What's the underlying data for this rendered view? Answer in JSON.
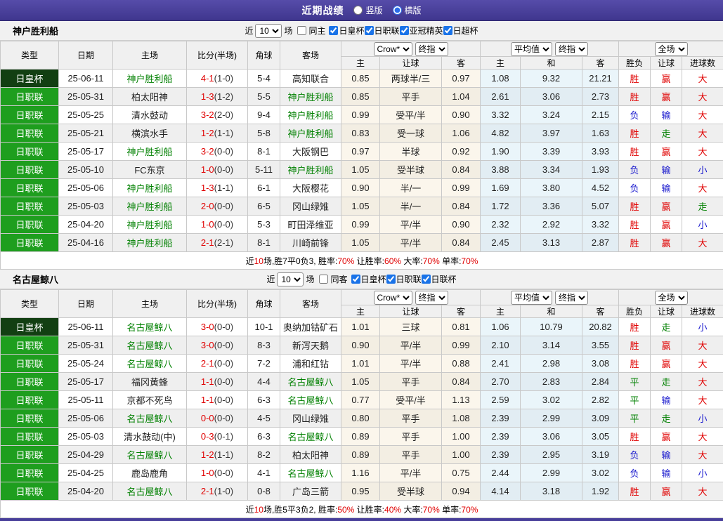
{
  "titlebar": {
    "title": "近期战绩",
    "radios": [
      {
        "label": "竖版",
        "checked": false
      },
      {
        "label": "横版",
        "checked": true
      }
    ]
  },
  "headers": {
    "main": [
      "类型",
      "日期",
      "主场",
      "比分(半场)",
      "角球",
      "客场"
    ],
    "sub": [
      "主",
      "让球",
      "客",
      "主",
      "和",
      "客",
      "胜负",
      "让球",
      "进球数"
    ],
    "odds_provider": "Crow*",
    "odds_stage": "终指",
    "avg_provider": "平均值",
    "avg_stage": "终指",
    "scope": "全场"
  },
  "tables": [
    {
      "team": "神户胜利船",
      "filter": {
        "prefix": "近",
        "count": "10",
        "suffix": "场",
        "venue_label": "同主",
        "venue_checked": false,
        "competitions": [
          {
            "label": "日皇杯",
            "checked": true
          },
          {
            "label": "日职联",
            "checked": true
          },
          {
            "label": "亚冠精英",
            "checked": true
          },
          {
            "label": "日超杯",
            "checked": true
          }
        ]
      },
      "rows": [
        {
          "type": "日皇杯",
          "cup": true,
          "date": "25-06-11",
          "home": "神户胜利船",
          "home_focus": true,
          "score": "4-1",
          "half": "(1-0)",
          "corner": "5-4",
          "away": "高知联合",
          "away_focus": false,
          "crow_home": "0.85",
          "crow_line": "两球半/三",
          "crow_away": "0.97",
          "avg_home": "1.08",
          "avg_draw": "9.32",
          "avg_away": "21.21",
          "res_outcome": {
            "t": "胜",
            "c": "red"
          },
          "res_handicap": {
            "t": "赢",
            "c": "red"
          },
          "res_goals": {
            "t": "大",
            "c": "red"
          }
        },
        {
          "type": "日职联",
          "cup": false,
          "date": "25-05-31",
          "home": "柏太阳神",
          "home_focus": false,
          "score": "1-3",
          "half": "(1-2)",
          "corner": "5-5",
          "away": "神户胜利船",
          "away_focus": true,
          "crow_home": "0.85",
          "crow_line": "平手",
          "crow_away": "1.04",
          "avg_home": "2.61",
          "avg_draw": "3.06",
          "avg_away": "2.73",
          "res_outcome": {
            "t": "胜",
            "c": "red"
          },
          "res_handicap": {
            "t": "赢",
            "c": "red"
          },
          "res_goals": {
            "t": "大",
            "c": "red"
          }
        },
        {
          "type": "日职联",
          "cup": false,
          "date": "25-05-25",
          "home": "清水鼓动",
          "home_focus": false,
          "score": "3-2",
          "half": "(2-0)",
          "corner": "9-4",
          "away": "神户胜利船",
          "away_focus": true,
          "crow_home": "0.99",
          "crow_line": "受平/半",
          "crow_away": "0.90",
          "avg_home": "3.32",
          "avg_draw": "3.24",
          "avg_away": "2.15",
          "res_outcome": {
            "t": "负",
            "c": "blue"
          },
          "res_handicap": {
            "t": "输",
            "c": "blue"
          },
          "res_goals": {
            "t": "大",
            "c": "red"
          }
        },
        {
          "type": "日职联",
          "cup": false,
          "date": "25-05-21",
          "home": "横滨水手",
          "home_focus": false,
          "score": "1-2",
          "half": "(1-1)",
          "corner": "5-8",
          "away": "神户胜利船",
          "away_focus": true,
          "crow_home": "0.83",
          "crow_line": "受一球",
          "crow_away": "1.06",
          "avg_home": "4.82",
          "avg_draw": "3.97",
          "avg_away": "1.63",
          "res_outcome": {
            "t": "胜",
            "c": "red"
          },
          "res_handicap": {
            "t": "走",
            "c": "green"
          },
          "res_goals": {
            "t": "大",
            "c": "red"
          }
        },
        {
          "type": "日职联",
          "cup": false,
          "date": "25-05-17",
          "home": "神户胜利船",
          "home_focus": true,
          "score": "3-2",
          "half": "(0-0)",
          "corner": "8-1",
          "away": "大阪钢巴",
          "away_focus": false,
          "crow_home": "0.97",
          "crow_line": "半球",
          "crow_away": "0.92",
          "avg_home": "1.90",
          "avg_draw": "3.39",
          "avg_away": "3.93",
          "res_outcome": {
            "t": "胜",
            "c": "red"
          },
          "res_handicap": {
            "t": "赢",
            "c": "red"
          },
          "res_goals": {
            "t": "大",
            "c": "red"
          }
        },
        {
          "type": "日职联",
          "cup": false,
          "date": "25-05-10",
          "home": "FC东京",
          "home_focus": false,
          "score": "1-0",
          "half": "(0-0)",
          "corner": "5-11",
          "away": "神户胜利船",
          "away_focus": true,
          "crow_home": "1.05",
          "crow_line": "受半球",
          "crow_away": "0.84",
          "avg_home": "3.88",
          "avg_draw": "3.34",
          "avg_away": "1.93",
          "res_outcome": {
            "t": "负",
            "c": "blue"
          },
          "res_handicap": {
            "t": "输",
            "c": "blue"
          },
          "res_goals": {
            "t": "小",
            "c": "blue"
          }
        },
        {
          "type": "日职联",
          "cup": false,
          "date": "25-05-06",
          "home": "神户胜利船",
          "home_focus": true,
          "score": "1-3",
          "half": "(1-1)",
          "corner": "6-1",
          "away": "大阪樱花",
          "away_focus": false,
          "crow_home": "0.90",
          "crow_line": "半/一",
          "crow_away": "0.99",
          "avg_home": "1.69",
          "avg_draw": "3.80",
          "avg_away": "4.52",
          "res_outcome": {
            "t": "负",
            "c": "blue"
          },
          "res_handicap": {
            "t": "输",
            "c": "blue"
          },
          "res_goals": {
            "t": "大",
            "c": "red"
          }
        },
        {
          "type": "日职联",
          "cup": false,
          "date": "25-05-03",
          "home": "神户胜利船",
          "home_focus": true,
          "score": "2-0",
          "half": "(0-0)",
          "corner": "6-5",
          "away": "冈山绿雉",
          "away_focus": false,
          "crow_home": "1.05",
          "crow_line": "半/一",
          "crow_away": "0.84",
          "avg_home": "1.72",
          "avg_draw": "3.36",
          "avg_away": "5.07",
          "res_outcome": {
            "t": "胜",
            "c": "red"
          },
          "res_handicap": {
            "t": "赢",
            "c": "red"
          },
          "res_goals": {
            "t": "走",
            "c": "green"
          }
        },
        {
          "type": "日职联",
          "cup": false,
          "date": "25-04-20",
          "home": "神户胜利船",
          "home_focus": true,
          "score": "1-0",
          "half": "(0-0)",
          "corner": "5-3",
          "away": "町田泽维亚",
          "away_focus": false,
          "crow_home": "0.99",
          "crow_line": "平/半",
          "crow_away": "0.90",
          "avg_home": "2.32",
          "avg_draw": "2.92",
          "avg_away": "3.32",
          "res_outcome": {
            "t": "胜",
            "c": "red"
          },
          "res_handicap": {
            "t": "赢",
            "c": "red"
          },
          "res_goals": {
            "t": "小",
            "c": "blue"
          }
        },
        {
          "type": "日职联",
          "cup": false,
          "date": "25-04-16",
          "home": "神户胜利船",
          "home_focus": true,
          "score": "2-1",
          "half": "(2-1)",
          "corner": "8-1",
          "away": "川崎前锋",
          "away_focus": false,
          "crow_home": "1.05",
          "crow_line": "平/半",
          "crow_away": "0.84",
          "avg_home": "2.45",
          "avg_draw": "3.13",
          "avg_away": "2.87",
          "res_outcome": {
            "t": "胜",
            "c": "red"
          },
          "res_handicap": {
            "t": "赢",
            "c": "red"
          },
          "res_goals": {
            "t": "大",
            "c": "red"
          }
        }
      ],
      "summary": [
        {
          "t": "近",
          "red": false
        },
        {
          "t": "10",
          "red": true
        },
        {
          "t": "场,胜7平0负3, 胜率:",
          "red": false
        },
        {
          "t": "70%",
          "red": true
        },
        {
          "t": " 让胜率:",
          "red": false
        },
        {
          "t": "60%",
          "red": true
        },
        {
          "t": " 大率:",
          "red": false
        },
        {
          "t": "70%",
          "red": true
        },
        {
          "t": " 单率:",
          "red": false
        },
        {
          "t": "70%",
          "red": true
        }
      ]
    },
    {
      "team": "名古屋鲸八",
      "filter": {
        "prefix": "近",
        "count": "10",
        "suffix": "场",
        "venue_label": "同客",
        "venue_checked": false,
        "competitions": [
          {
            "label": "日皇杯",
            "checked": true
          },
          {
            "label": "日职联",
            "checked": true
          },
          {
            "label": "日联杯",
            "checked": true
          }
        ]
      },
      "rows": [
        {
          "type": "日皇杯",
          "cup": true,
          "date": "25-06-11",
          "home": "名古屋鲸八",
          "home_focus": true,
          "score": "3-0",
          "half": "(0-0)",
          "corner": "10-1",
          "away": "奥纳加钴矿石",
          "away_focus": false,
          "crow_home": "1.01",
          "crow_line": "三球",
          "crow_away": "0.81",
          "avg_home": "1.06",
          "avg_draw": "10.79",
          "avg_away": "20.82",
          "res_outcome": {
            "t": "胜",
            "c": "red"
          },
          "res_handicap": {
            "t": "走",
            "c": "green"
          },
          "res_goals": {
            "t": "小",
            "c": "blue"
          }
        },
        {
          "type": "日职联",
          "cup": false,
          "date": "25-05-31",
          "home": "名古屋鲸八",
          "home_focus": true,
          "score": "3-0",
          "half": "(0-0)",
          "corner": "8-3",
          "away": "新泻天鹅",
          "away_focus": false,
          "crow_home": "0.90",
          "crow_line": "平/半",
          "crow_away": "0.99",
          "avg_home": "2.10",
          "avg_draw": "3.14",
          "avg_away": "3.55",
          "res_outcome": {
            "t": "胜",
            "c": "red"
          },
          "res_handicap": {
            "t": "赢",
            "c": "red"
          },
          "res_goals": {
            "t": "大",
            "c": "red"
          }
        },
        {
          "type": "日职联",
          "cup": false,
          "date": "25-05-24",
          "home": "名古屋鲸八",
          "home_focus": true,
          "score": "2-1",
          "half": "(0-0)",
          "corner": "7-2",
          "away": "浦和红钻",
          "away_focus": false,
          "crow_home": "1.01",
          "crow_line": "平/半",
          "crow_away": "0.88",
          "avg_home": "2.41",
          "avg_draw": "2.98",
          "avg_away": "3.08",
          "res_outcome": {
            "t": "胜",
            "c": "red"
          },
          "res_handicap": {
            "t": "赢",
            "c": "red"
          },
          "res_goals": {
            "t": "大",
            "c": "red"
          }
        },
        {
          "type": "日职联",
          "cup": false,
          "date": "25-05-17",
          "home": "福冈黄蜂",
          "home_focus": false,
          "score": "1-1",
          "half": "(0-0)",
          "corner": "4-4",
          "away": "名古屋鲸八",
          "away_focus": true,
          "crow_home": "1.05",
          "crow_line": "平手",
          "crow_away": "0.84",
          "avg_home": "2.70",
          "avg_draw": "2.83",
          "avg_away": "2.84",
          "res_outcome": {
            "t": "平",
            "c": "green"
          },
          "res_handicap": {
            "t": "走",
            "c": "green"
          },
          "res_goals": {
            "t": "大",
            "c": "red"
          }
        },
        {
          "type": "日职联",
          "cup": false,
          "date": "25-05-11",
          "home": "京都不死鸟",
          "home_focus": false,
          "score": "1-1",
          "half": "(0-0)",
          "corner": "6-3",
          "away": "名古屋鲸八",
          "away_focus": true,
          "crow_home": "0.77",
          "crow_line": "受平/半",
          "crow_away": "1.13",
          "avg_home": "2.59",
          "avg_draw": "3.02",
          "avg_away": "2.82",
          "res_outcome": {
            "t": "平",
            "c": "green"
          },
          "res_handicap": {
            "t": "输",
            "c": "blue"
          },
          "res_goals": {
            "t": "大",
            "c": "red"
          }
        },
        {
          "type": "日职联",
          "cup": false,
          "date": "25-05-06",
          "home": "名古屋鲸八",
          "home_focus": true,
          "score": "0-0",
          "half": "(0-0)",
          "corner": "4-5",
          "away": "冈山绿雉",
          "away_focus": false,
          "crow_home": "0.80",
          "crow_line": "平手",
          "crow_away": "1.08",
          "avg_home": "2.39",
          "avg_draw": "2.99",
          "avg_away": "3.09",
          "res_outcome": {
            "t": "平",
            "c": "green"
          },
          "res_handicap": {
            "t": "走",
            "c": "green"
          },
          "res_goals": {
            "t": "小",
            "c": "blue"
          }
        },
        {
          "type": "日职联",
          "cup": false,
          "date": "25-05-03",
          "home": "清水鼓动(中)",
          "home_focus": false,
          "score": "0-3",
          "half": "(0-1)",
          "corner": "6-3",
          "away": "名古屋鲸八",
          "away_focus": true,
          "crow_home": "0.89",
          "crow_line": "平手",
          "crow_away": "1.00",
          "avg_home": "2.39",
          "avg_draw": "3.06",
          "avg_away": "3.05",
          "res_outcome": {
            "t": "胜",
            "c": "red"
          },
          "res_handicap": {
            "t": "赢",
            "c": "red"
          },
          "res_goals": {
            "t": "大",
            "c": "red"
          }
        },
        {
          "type": "日职联",
          "cup": false,
          "date": "25-04-29",
          "home": "名古屋鲸八",
          "home_focus": true,
          "score": "1-2",
          "half": "(1-1)",
          "corner": "8-2",
          "away": "柏太阳神",
          "away_focus": false,
          "crow_home": "0.89",
          "crow_line": "平手",
          "crow_away": "1.00",
          "avg_home": "2.39",
          "avg_draw": "2.95",
          "avg_away": "3.19",
          "res_outcome": {
            "t": "负",
            "c": "blue"
          },
          "res_handicap": {
            "t": "输",
            "c": "blue"
          },
          "res_goals": {
            "t": "大",
            "c": "red"
          }
        },
        {
          "type": "日职联",
          "cup": false,
          "date": "25-04-25",
          "home": "鹿岛鹿角",
          "home_focus": false,
          "score": "1-0",
          "half": "(0-0)",
          "corner": "4-1",
          "away": "名古屋鲸八",
          "away_focus": true,
          "crow_home": "1.16",
          "crow_line": "平/半",
          "crow_away": "0.75",
          "avg_home": "2.44",
          "avg_draw": "2.99",
          "avg_away": "3.02",
          "res_outcome": {
            "t": "负",
            "c": "blue"
          },
          "res_handicap": {
            "t": "输",
            "c": "blue"
          },
          "res_goals": {
            "t": "小",
            "c": "blue"
          }
        },
        {
          "type": "日职联",
          "cup": false,
          "date": "25-04-20",
          "home": "名古屋鲸八",
          "home_focus": true,
          "score": "2-1",
          "half": "(1-0)",
          "corner": "0-8",
          "away": "广岛三箭",
          "away_focus": false,
          "crow_home": "0.95",
          "crow_line": "受半球",
          "crow_away": "0.94",
          "avg_home": "4.14",
          "avg_draw": "3.18",
          "avg_away": "1.92",
          "res_outcome": {
            "t": "胜",
            "c": "red"
          },
          "res_handicap": {
            "t": "赢",
            "c": "red"
          },
          "res_goals": {
            "t": "大",
            "c": "red"
          }
        }
      ],
      "summary": [
        {
          "t": "近",
          "red": false
        },
        {
          "t": "10",
          "red": true
        },
        {
          "t": "场,胜5平3负2, 胜率:",
          "red": false
        },
        {
          "t": "50%",
          "red": true
        },
        {
          "t": " 让胜率:",
          "red": false
        },
        {
          "t": "40%",
          "red": true
        },
        {
          "t": " 大率:",
          "red": false
        },
        {
          "t": "70%",
          "red": true
        },
        {
          "t": " 单率:",
          "red": false
        },
        {
          "t": "70%",
          "red": true
        }
      ]
    }
  ]
}
